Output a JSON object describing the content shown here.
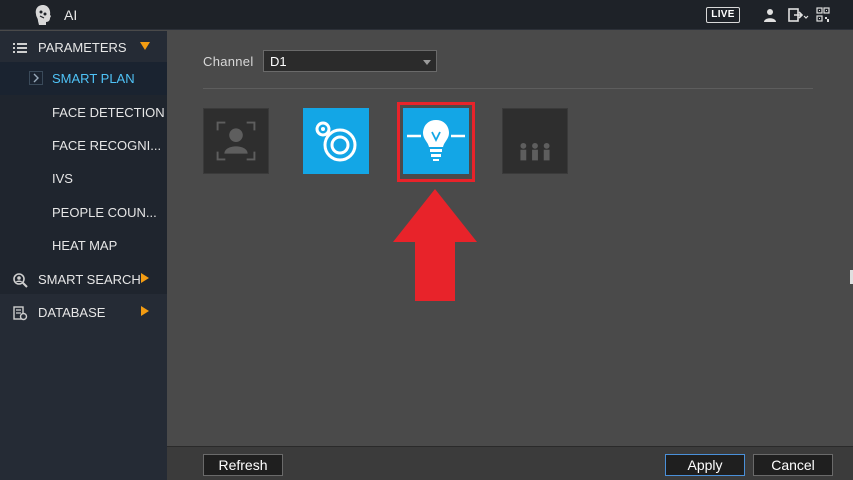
{
  "header": {
    "title": "AI",
    "live_label": "LIVE",
    "icons": [
      "app-logo-icon",
      "user-icon",
      "logout-icon",
      "qr-code-icon"
    ]
  },
  "sidebar": {
    "groups": [
      {
        "label": "PARAMETERS",
        "icon": "list-icon",
        "expanded": true
      },
      {
        "label": "SMART SEARCH",
        "icon": "search-person-icon",
        "expanded": false
      },
      {
        "label": "DATABASE",
        "icon": "database-icon",
        "expanded": false
      }
    ],
    "sub_items": [
      {
        "label": "SMART PLAN",
        "active": true
      },
      {
        "label": "FACE DETECTION",
        "active": false
      },
      {
        "label": "FACE RECOGNI...",
        "active": false
      },
      {
        "label": "IVS",
        "active": false
      },
      {
        "label": "PEOPLE COUN...",
        "active": false
      },
      {
        "label": "HEAT MAP",
        "active": false
      }
    ]
  },
  "main": {
    "channel_label": "Channel",
    "channel_value": "D1",
    "plan_tiles": [
      {
        "name": "face-recognition",
        "icon": "face-frame-icon",
        "selected": false
      },
      {
        "name": "ivs",
        "icon": "ivs-circles-icon",
        "selected": true
      },
      {
        "name": "heat-map",
        "icon": "lightbulb-icon",
        "selected": true
      },
      {
        "name": "people-counting",
        "icon": "people-group-icon",
        "selected": false
      }
    ]
  },
  "footer": {
    "refresh_label": "Refresh",
    "apply_label": "Apply",
    "cancel_label": "Cancel"
  },
  "colors": {
    "accent": "#13a6e6",
    "active_text": "#4fc3f7",
    "highlight": "#e8232a",
    "submenu_arrow": "#f39c12"
  }
}
